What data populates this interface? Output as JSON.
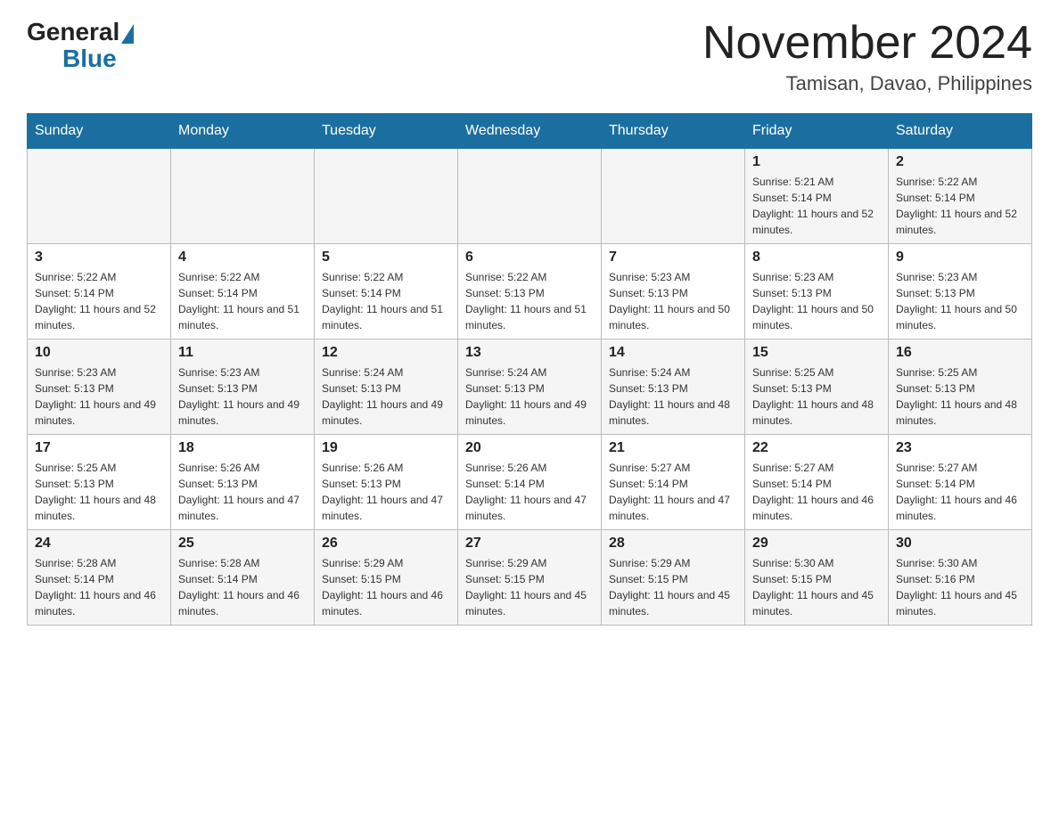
{
  "header": {
    "logo": {
      "general": "General",
      "blue": "Blue"
    },
    "title": "November 2024",
    "location": "Tamisan, Davao, Philippines"
  },
  "calendar": {
    "days_of_week": [
      "Sunday",
      "Monday",
      "Tuesday",
      "Wednesday",
      "Thursday",
      "Friday",
      "Saturday"
    ],
    "weeks": [
      [
        {
          "day": "",
          "info": ""
        },
        {
          "day": "",
          "info": ""
        },
        {
          "day": "",
          "info": ""
        },
        {
          "day": "",
          "info": ""
        },
        {
          "day": "",
          "info": ""
        },
        {
          "day": "1",
          "info": "Sunrise: 5:21 AM\nSunset: 5:14 PM\nDaylight: 11 hours and 52 minutes."
        },
        {
          "day": "2",
          "info": "Sunrise: 5:22 AM\nSunset: 5:14 PM\nDaylight: 11 hours and 52 minutes."
        }
      ],
      [
        {
          "day": "3",
          "info": "Sunrise: 5:22 AM\nSunset: 5:14 PM\nDaylight: 11 hours and 52 minutes."
        },
        {
          "day": "4",
          "info": "Sunrise: 5:22 AM\nSunset: 5:14 PM\nDaylight: 11 hours and 51 minutes."
        },
        {
          "day": "5",
          "info": "Sunrise: 5:22 AM\nSunset: 5:14 PM\nDaylight: 11 hours and 51 minutes."
        },
        {
          "day": "6",
          "info": "Sunrise: 5:22 AM\nSunset: 5:13 PM\nDaylight: 11 hours and 51 minutes."
        },
        {
          "day": "7",
          "info": "Sunrise: 5:23 AM\nSunset: 5:13 PM\nDaylight: 11 hours and 50 minutes."
        },
        {
          "day": "8",
          "info": "Sunrise: 5:23 AM\nSunset: 5:13 PM\nDaylight: 11 hours and 50 minutes."
        },
        {
          "day": "9",
          "info": "Sunrise: 5:23 AM\nSunset: 5:13 PM\nDaylight: 11 hours and 50 minutes."
        }
      ],
      [
        {
          "day": "10",
          "info": "Sunrise: 5:23 AM\nSunset: 5:13 PM\nDaylight: 11 hours and 49 minutes."
        },
        {
          "day": "11",
          "info": "Sunrise: 5:23 AM\nSunset: 5:13 PM\nDaylight: 11 hours and 49 minutes."
        },
        {
          "day": "12",
          "info": "Sunrise: 5:24 AM\nSunset: 5:13 PM\nDaylight: 11 hours and 49 minutes."
        },
        {
          "day": "13",
          "info": "Sunrise: 5:24 AM\nSunset: 5:13 PM\nDaylight: 11 hours and 49 minutes."
        },
        {
          "day": "14",
          "info": "Sunrise: 5:24 AM\nSunset: 5:13 PM\nDaylight: 11 hours and 48 minutes."
        },
        {
          "day": "15",
          "info": "Sunrise: 5:25 AM\nSunset: 5:13 PM\nDaylight: 11 hours and 48 minutes."
        },
        {
          "day": "16",
          "info": "Sunrise: 5:25 AM\nSunset: 5:13 PM\nDaylight: 11 hours and 48 minutes."
        }
      ],
      [
        {
          "day": "17",
          "info": "Sunrise: 5:25 AM\nSunset: 5:13 PM\nDaylight: 11 hours and 48 minutes."
        },
        {
          "day": "18",
          "info": "Sunrise: 5:26 AM\nSunset: 5:13 PM\nDaylight: 11 hours and 47 minutes."
        },
        {
          "day": "19",
          "info": "Sunrise: 5:26 AM\nSunset: 5:13 PM\nDaylight: 11 hours and 47 minutes."
        },
        {
          "day": "20",
          "info": "Sunrise: 5:26 AM\nSunset: 5:14 PM\nDaylight: 11 hours and 47 minutes."
        },
        {
          "day": "21",
          "info": "Sunrise: 5:27 AM\nSunset: 5:14 PM\nDaylight: 11 hours and 47 minutes."
        },
        {
          "day": "22",
          "info": "Sunrise: 5:27 AM\nSunset: 5:14 PM\nDaylight: 11 hours and 46 minutes."
        },
        {
          "day": "23",
          "info": "Sunrise: 5:27 AM\nSunset: 5:14 PM\nDaylight: 11 hours and 46 minutes."
        }
      ],
      [
        {
          "day": "24",
          "info": "Sunrise: 5:28 AM\nSunset: 5:14 PM\nDaylight: 11 hours and 46 minutes."
        },
        {
          "day": "25",
          "info": "Sunrise: 5:28 AM\nSunset: 5:14 PM\nDaylight: 11 hours and 46 minutes."
        },
        {
          "day": "26",
          "info": "Sunrise: 5:29 AM\nSunset: 5:15 PM\nDaylight: 11 hours and 46 minutes."
        },
        {
          "day": "27",
          "info": "Sunrise: 5:29 AM\nSunset: 5:15 PM\nDaylight: 11 hours and 45 minutes."
        },
        {
          "day": "28",
          "info": "Sunrise: 5:29 AM\nSunset: 5:15 PM\nDaylight: 11 hours and 45 minutes."
        },
        {
          "day": "29",
          "info": "Sunrise: 5:30 AM\nSunset: 5:15 PM\nDaylight: 11 hours and 45 minutes."
        },
        {
          "day": "30",
          "info": "Sunrise: 5:30 AM\nSunset: 5:16 PM\nDaylight: 11 hours and 45 minutes."
        }
      ]
    ]
  }
}
